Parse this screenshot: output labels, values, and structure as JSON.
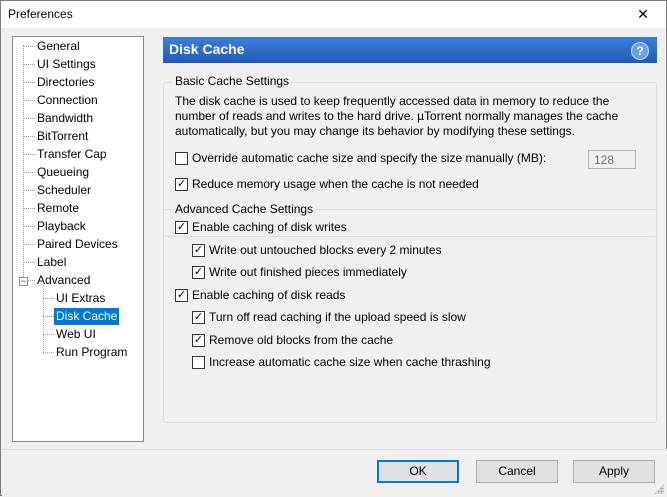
{
  "window": {
    "title": "Preferences",
    "close_glyph": "✕"
  },
  "tree": {
    "items": [
      "General",
      "UI Settings",
      "Directories",
      "Connection",
      "Bandwidth",
      "BitTorrent",
      "Transfer Cap",
      "Queueing",
      "Scheduler",
      "Remote",
      "Playback",
      "Paired Devices",
      "Label",
      "Advanced"
    ],
    "advanced_children": [
      "UI Extras",
      "Disk Cache",
      "Web UI",
      "Run Program"
    ],
    "selected": "Disk Cache",
    "expander_glyph": "−"
  },
  "panel": {
    "title": "Disk Cache",
    "help_glyph": "?",
    "basic": {
      "legend": "Basic Cache Settings",
      "description": "The disk cache is used to keep frequently accessed data in memory to reduce the number of reads and writes to the hard drive. µTorrent normally manages the cache automatically, but you may change its behavior by modifying these settings.",
      "override_label": "Override automatic cache size and specify the size manually (MB):",
      "override_checked": false,
      "cache_size_value": "128",
      "reduce_label": "Reduce memory usage when the cache is not needed",
      "reduce_checked": true
    },
    "advanced": {
      "legend": "Advanced Cache Settings",
      "enable_writes_label": "Enable caching of disk writes",
      "enable_writes_checked": true,
      "untouched_label": "Write out untouched blocks every 2 minutes",
      "untouched_checked": true,
      "finished_label": "Write out finished pieces immediately",
      "finished_checked": true,
      "enable_reads_label": "Enable caching of disk reads",
      "enable_reads_checked": true,
      "turn_off_label": "Turn off read caching if the upload speed is slow",
      "turn_off_checked": true,
      "remove_label": "Remove old blocks from the cache",
      "remove_checked": true,
      "increase_label": "Increase automatic cache size when cache thrashing",
      "increase_checked": false
    }
  },
  "buttons": {
    "ok": "OK",
    "cancel": "Cancel",
    "apply": "Apply"
  },
  "check_glyph": "✓"
}
